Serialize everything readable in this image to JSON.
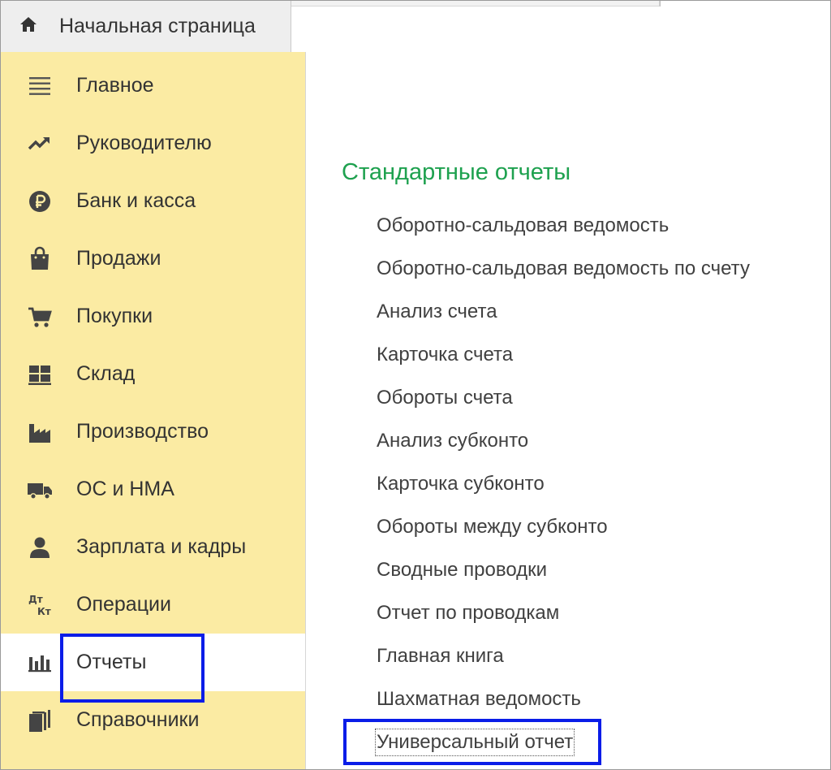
{
  "tabs": {
    "home_label": "Начальная страница"
  },
  "sidebar": {
    "items": [
      {
        "label": "Главное",
        "icon": "menu-lines-icon"
      },
      {
        "label": "Руководителю",
        "icon": "trend-up-icon"
      },
      {
        "label": "Банк и касса",
        "icon": "ruble-coin-icon"
      },
      {
        "label": "Продажи",
        "icon": "shopping-bag-icon"
      },
      {
        "label": "Покупки",
        "icon": "cart-icon"
      },
      {
        "label": "Склад",
        "icon": "warehouse-grid-icon"
      },
      {
        "label": "Производство",
        "icon": "factory-icon"
      },
      {
        "label": "ОС и НМА",
        "icon": "truck-icon"
      },
      {
        "label": "Зарплата и кадры",
        "icon": "person-icon"
      },
      {
        "label": "Операции",
        "icon": "debit-credit-icon",
        "icon_text_top": "Дт",
        "icon_text_bottom": "Кт"
      },
      {
        "label": "Отчеты",
        "icon": "bar-chart-icon",
        "active": true
      },
      {
        "label": "Справочники",
        "icon": "books-icon"
      }
    ]
  },
  "content": {
    "section_title": "Стандартные отчеты",
    "reports": [
      "Оборотно-сальдовая ведомость",
      "Оборотно-сальдовая ведомость по счету",
      "Анализ счета",
      "Карточка счета",
      "Обороты счета",
      "Анализ субконто",
      "Карточка субконто",
      "Обороты между субконто",
      "Сводные проводки",
      "Отчет по проводкам",
      "Главная книга",
      "Шахматная ведомость",
      "Универсальный отчет"
    ]
  },
  "colors": {
    "sidebar_bg": "#fbeba3",
    "section_title": "#1ea14f",
    "highlight_border": "#0a1de8"
  }
}
